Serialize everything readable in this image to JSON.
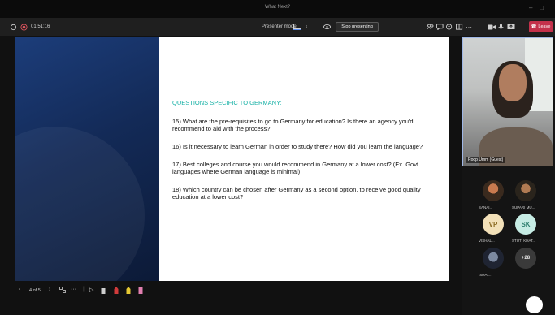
{
  "window": {
    "title": "What Next?"
  },
  "toolbar": {
    "timer": "01:51:16",
    "presenter_mode_label": "Presenter mode",
    "stop_presenting": "Stop presenting",
    "leave": "Leave"
  },
  "slide": {
    "heading": "QUESTIONS SPECIFIC TO GERMANY:",
    "questions": [
      "15) What are the pre-requisites to go to Germany for education? Is there an agency you'd recommend to aid with the process?",
      "16) Is it necessary to learn German in order to study there? How did you learn the language?",
      "17) Best colleges and course you would recommend in Germany at a lower cost? (Ex. Govt. languages where German language is minimal)",
      "18) Which country can be chosen after Germany as a second option, to receive good quality education at a lower cost?"
    ]
  },
  "slide_nav": {
    "page": "4 of 5"
  },
  "video": {
    "name": "Roop Umm (Guest)"
  },
  "participants": [
    {
      "label": "SANAI...",
      "initials": ""
    },
    {
      "label": "SUPARI MU...",
      "initials": ""
    },
    {
      "label": "VISHAL...",
      "initials": "VP",
      "color": "#f2e0b8",
      "text_color": "#8a6a22"
    },
    {
      "label": "STUTI KHAT...",
      "initials": "SK",
      "color": "#c6ece4",
      "text_color": "#2a7c6c"
    },
    {
      "label": "ISHAI...",
      "initials": ""
    },
    {
      "label": "",
      "initials": "+28"
    }
  ]
}
